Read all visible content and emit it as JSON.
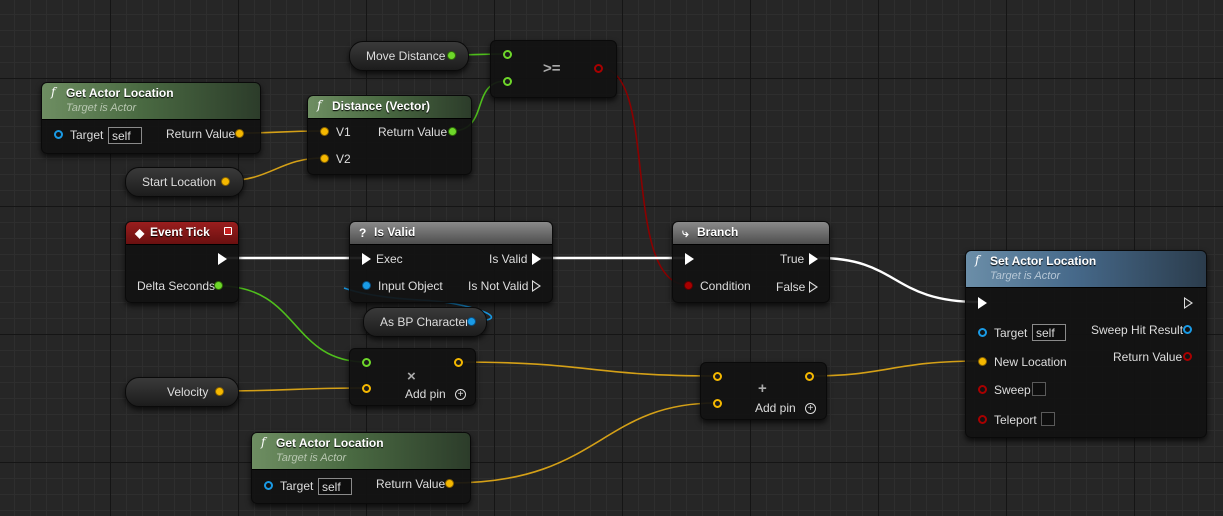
{
  "nodes": {
    "get_loc_1": {
      "title": "Get Actor Location",
      "subtitle": "Target is Actor",
      "target_label": "Target",
      "self_value": "self",
      "return_label": "Return Value"
    },
    "distance": {
      "title": "Distance (Vector)",
      "v1_label": "V1",
      "v2_label": "V2",
      "return_label": "Return Value"
    },
    "move_distance": {
      "label": "Move Distance"
    },
    "compare": {
      "operator": ">="
    },
    "start_location": {
      "label": "Start Location"
    },
    "event_tick": {
      "title": "Event Tick",
      "delta_label": "Delta Seconds"
    },
    "is_valid": {
      "title": "Is Valid",
      "exec_label": "Exec",
      "input_label": "Input Object",
      "valid_label": "Is Valid",
      "notvalid_label": "Is Not Valid"
    },
    "as_bp": {
      "label": "As BP Character"
    },
    "branch": {
      "title": "Branch",
      "condition_label": "Condition",
      "true_label": "True",
      "false_label": "False"
    },
    "multiply": {
      "operator": "×",
      "addpin_label": "Add pin"
    },
    "velocity": {
      "label": "Velocity"
    },
    "add": {
      "operator": "+",
      "addpin_label": "Add pin"
    },
    "get_loc_2": {
      "title": "Get Actor Location",
      "subtitle": "Target is Actor",
      "target_label": "Target",
      "self_value": "self",
      "return_label": "Return Value"
    },
    "set_loc": {
      "title": "Set Actor Location",
      "subtitle": "Target is Actor",
      "target_label": "Target",
      "self_value": "self",
      "newloc_label": "New Location",
      "sweep_label": "Sweep",
      "teleport_label": "Teleport",
      "hit_label": "Sweep Hit Result",
      "return_label": "Return Value"
    }
  },
  "colors": {
    "vector_wire": "#d4a017",
    "float_wire": "#4fbf1c",
    "bool_wire": "#8b0000",
    "exec_wire": "#ffffff",
    "object_wire": "#1a9be6"
  }
}
